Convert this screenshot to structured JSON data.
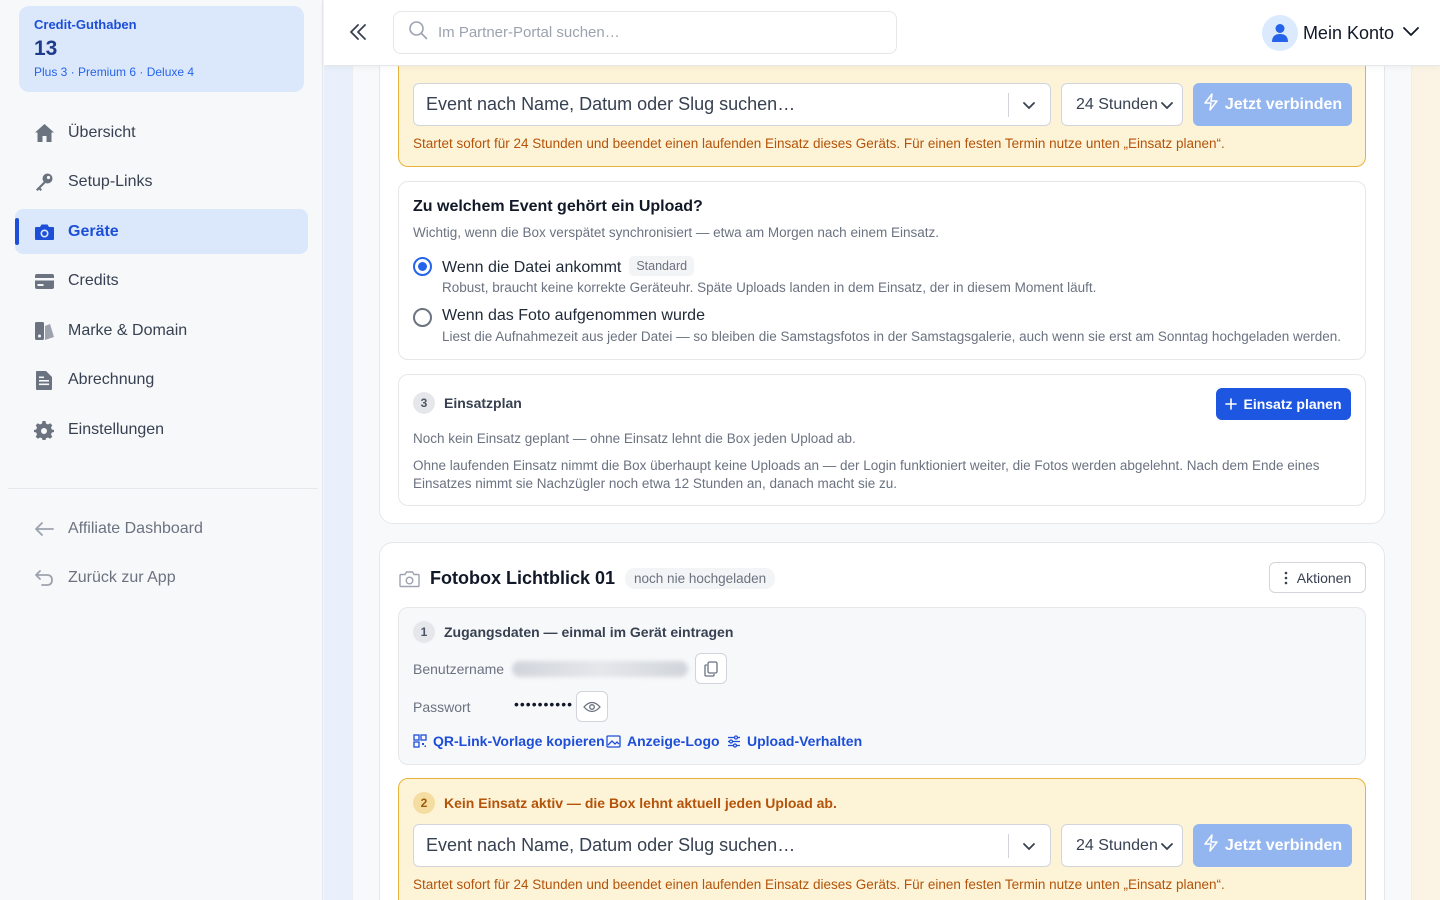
{
  "sidebar": {
    "credit": {
      "label": "Credit-Guthaben",
      "value": "13",
      "breakdown": "Plus 3 · Premium 6 · Deluxe 4"
    },
    "items": [
      {
        "label": "Übersicht",
        "icon": "home-icon"
      },
      {
        "label": "Setup-Links",
        "icon": "key-icon"
      },
      {
        "label": "Geräte",
        "icon": "camera-icon",
        "active": true
      },
      {
        "label": "Credits",
        "icon": "card-icon"
      },
      {
        "label": "Marke & Domain",
        "icon": "brand-icon"
      },
      {
        "label": "Abrechnung",
        "icon": "document-icon"
      },
      {
        "label": "Einstellungen",
        "icon": "gear-icon"
      }
    ],
    "secondary": [
      {
        "label": "Affiliate Dashboard",
        "icon": "arrow-left-icon"
      },
      {
        "label": "Zurück zur App",
        "icon": "undo-icon"
      }
    ]
  },
  "topbar": {
    "search_placeholder": "Im Partner-Portal suchen…",
    "account_label": "Mein Konto"
  },
  "device1": {
    "warn_step": {
      "event_placeholder": "Event nach Name, Datum oder Slug suchen…",
      "hours": "24 Stunden",
      "connect": "Jetzt verbinden",
      "hint": "Startet sofort für 24 Stunden und beendet einen laufenden Einsatz dieses Geräts. Für einen festen Termin nutze unten „Einsatz planen“."
    },
    "upload_assign": {
      "title": "Zu welchem Event gehört ein Upload?",
      "subtitle": "Wichtig, wenn die Box verspätet synchronisiert — etwa am Morgen nach einem Einsatz.",
      "options": [
        {
          "label": "Wenn die Datei ankommt",
          "badge": "Standard",
          "desc": "Robust, braucht keine korrekte Geräteuhr. Späte Uploads landen in dem Einsatz, der in diesem Moment läuft.",
          "selected": true
        },
        {
          "label": "Wenn das Foto aufgenommen wurde",
          "desc": "Liest die Aufnahmezeit aus jeder Datei — so bleiben die Samstagsfotos in der Samstagsgalerie, auch wenn sie erst am Sonntag hochgeladen werden.",
          "selected": false
        }
      ]
    },
    "schedule": {
      "step": "3",
      "title": "Einsatzplan",
      "button": "Einsatz planen",
      "empty": "Noch kein Einsatz geplant — ohne Einsatz lehnt die Box jeden Upload ab.",
      "info_line1": "Ohne laufenden Einsatz nimmt die Box überhaupt keine Uploads an — der Login funktioniert weiter, die Fotos werden abgelehnt. Nach dem Ende eines",
      "info_line2": "Einsatzes nimmt sie Nachzügler noch etwa 12 Stunden an, danach macht sie zu."
    }
  },
  "device2": {
    "name": "Fotobox Lichtblick 01",
    "status": "noch nie hochgeladen",
    "actions": "Aktionen",
    "credentials": {
      "step": "1",
      "title": "Zugangsdaten — einmal im Gerät eintragen",
      "username_label": "Benutzername",
      "password_label": "Passwort",
      "password_value": "••••••••••",
      "links": [
        "QR-Link-Vorlage kopieren",
        "Anzeige-Logo",
        "Upload-Verhalten"
      ]
    },
    "warn_step": {
      "step": "2",
      "title": "Kein Einsatz aktiv — die Box lehnt aktuell jeden Upload ab.",
      "event_placeholder": "Event nach Name, Datum oder Slug suchen…",
      "hours": "24 Stunden",
      "connect": "Jetzt verbinden",
      "hint": "Startet sofort für 24 Stunden und beendet einen laufenden Einsatz dieses Geräts. Für einen festen Termin nutze unten „Einsatz planen“."
    }
  },
  "colors": {
    "accent": "#1d56e0",
    "warning_bg": "#fdf4d8",
    "warning_border": "#e7b23c",
    "active_nav_bg": "#dbe8fb"
  }
}
